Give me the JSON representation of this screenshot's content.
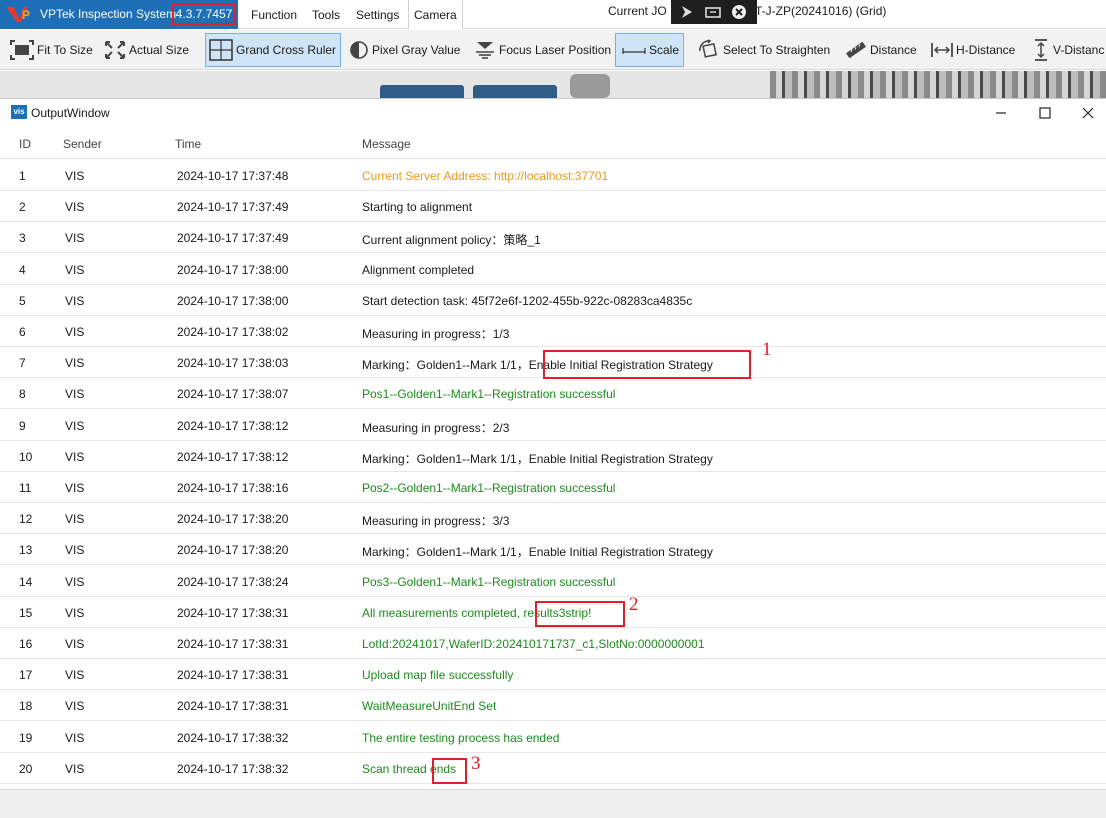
{
  "app": {
    "title": "VPTek Inspection System",
    "version": "4.3.7.7457",
    "logo_text": "VP",
    "current_job_prefix": "Current JO",
    "current_job_suffix": "T-J-ZP(20241016) (Grid)"
  },
  "menu": [
    "Function",
    "Tools",
    "Settings",
    "Camera"
  ],
  "toolbar": [
    {
      "label": "Fit To Size",
      "icon": "fit-to-size-icon"
    },
    {
      "label": "Actual Size",
      "icon": "actual-size-icon"
    },
    {
      "label": "Grand Cross Ruler",
      "icon": "grand-cross-ruler-icon",
      "active": true
    },
    {
      "label": "Pixel Gray Value",
      "icon": "pixel-gray-icon"
    },
    {
      "label": "Focus Laser Position",
      "icon": "focus-laser-icon"
    },
    {
      "label": "Scale",
      "icon": "scale-icon",
      "active": true
    },
    {
      "label": "Select To Straighten",
      "icon": "straighten-icon"
    },
    {
      "label": "Distance",
      "icon": "ruler-icon"
    },
    {
      "label": "H-Distance",
      "icon": "h-distance-icon"
    },
    {
      "label": "V-Distanc",
      "icon": "v-distance-icon"
    }
  ],
  "output_window": {
    "title": "OutputWindow",
    "icon_text": "vis",
    "columns": [
      "ID",
      "Sender",
      "Time",
      "Message"
    ],
    "rows": [
      {
        "id": "1",
        "sender": "VIS",
        "time": "2024-10-17 17:37:48",
        "message": "Current Server Address: http://localhost:37701",
        "color": "#e69a1e"
      },
      {
        "id": "2",
        "sender": "VIS",
        "time": "2024-10-17 17:37:49",
        "message": "Starting to  alignment",
        "color": "#1a1a1a"
      },
      {
        "id": "3",
        "sender": "VIS",
        "time": "2024-10-17 17:37:49",
        "message": "Current alignment policy：策略_1",
        "color": "#1a1a1a"
      },
      {
        "id": "4",
        "sender": "VIS",
        "time": "2024-10-17 17:38:00",
        "message": "Alignment completed",
        "color": "#1a1a1a"
      },
      {
        "id": "5",
        "sender": "VIS",
        "time": "2024-10-17 17:38:00",
        "message": "Start detection task:  45f72e6f-1202-455b-922c-08283ca4835c",
        "color": "#1a1a1a"
      },
      {
        "id": "6",
        "sender": "VIS",
        "time": "2024-10-17 17:38:02",
        "message": "Measuring in progress：1/3",
        "color": "#1a1a1a"
      },
      {
        "id": "7",
        "sender": "VIS",
        "time": "2024-10-17 17:38:03",
        "message": "Marking：Golden1--Mark 1/1，Enable Initial Registration Strategy",
        "color": "#1a1a1a"
      },
      {
        "id": "8",
        "sender": "VIS",
        "time": "2024-10-17 17:38:07",
        "message": "Pos1--Golden1--Mark1--Registration successful",
        "color": "#1e8a1e"
      },
      {
        "id": "9",
        "sender": "VIS",
        "time": "2024-10-17 17:38:12",
        "message": "Measuring in progress：2/3",
        "color": "#1a1a1a"
      },
      {
        "id": "10",
        "sender": "VIS",
        "time": "2024-10-17 17:38:12",
        "message": "Marking：Golden1--Mark 1/1，Enable Initial Registration Strategy",
        "color": "#1a1a1a"
      },
      {
        "id": "11",
        "sender": "VIS",
        "time": "2024-10-17 17:38:16",
        "message": "Pos2--Golden1--Mark1--Registration successful",
        "color": "#1e8a1e"
      },
      {
        "id": "12",
        "sender": "VIS",
        "time": "2024-10-17 17:38:20",
        "message": "Measuring in progress：3/3",
        "color": "#1a1a1a"
      },
      {
        "id": "13",
        "sender": "VIS",
        "time": "2024-10-17 17:38:20",
        "message": "Marking：Golden1--Mark 1/1，Enable Initial Registration Strategy",
        "color": "#1a1a1a"
      },
      {
        "id": "14",
        "sender": "VIS",
        "time": "2024-10-17 17:38:24",
        "message": "Pos3--Golden1--Mark1--Registration successful",
        "color": "#1e8a1e"
      },
      {
        "id": "15",
        "sender": "VIS",
        "time": "2024-10-17 17:38:31",
        "message": "All measurements completed, results3strip!",
        "color": "#1e8a1e"
      },
      {
        "id": "16",
        "sender": "VIS",
        "time": "2024-10-17 17:38:31",
        "message": "LotId:20241017,WaferID:202410171737_c1,SlotNo:0000000001",
        "color": "#1e8a1e"
      },
      {
        "id": "17",
        "sender": "VIS",
        "time": "2024-10-17 17:38:31",
        "message": "Upload map file successfully",
        "color": "#1e8a1e"
      },
      {
        "id": "18",
        "sender": "VIS",
        "time": "2024-10-17 17:38:31",
        "message": "WaitMeasureUnitEnd Set",
        "color": "#1e8a1e"
      },
      {
        "id": "19",
        "sender": "VIS",
        "time": "2024-10-17 17:38:32",
        "message": "The entire testing process has ended",
        "color": "#1e8a1e"
      },
      {
        "id": "20",
        "sender": "VIS",
        "time": "2024-10-17 17:38:32",
        "message": "Scan thread ends",
        "color": "#1e8a1e"
      }
    ]
  },
  "annotations": [
    "1",
    "2",
    "3"
  ],
  "colors": {
    "brand": "#1f6fb8",
    "highlight": "#e0202a",
    "success": "#1e8a1e",
    "info": "#e69a1e"
  }
}
